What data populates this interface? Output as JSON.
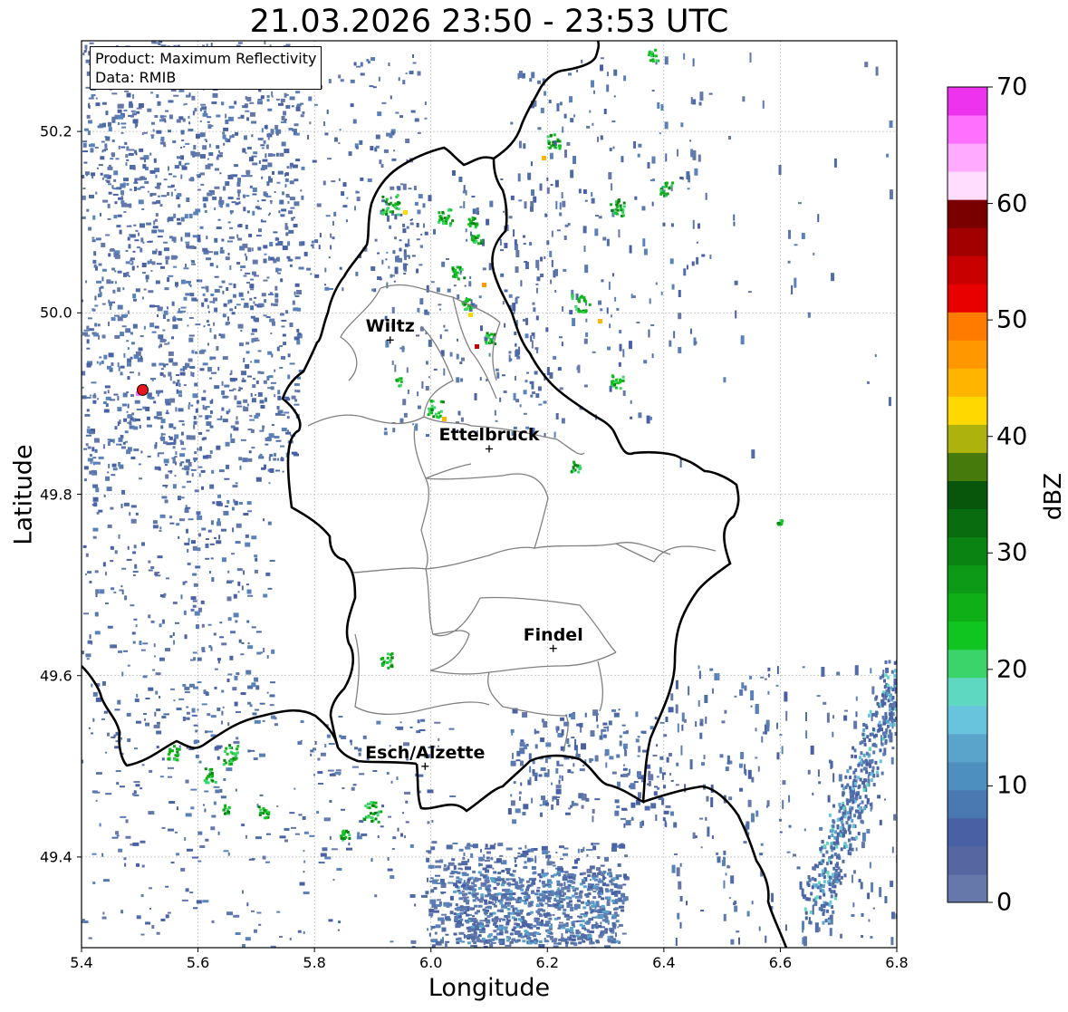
{
  "title": "21.03.2026 23:50 - 23:53 UTC",
  "xlabel": "Longitude",
  "ylabel": "Latitude",
  "info": {
    "product_line": "Product: Maximum Reflectivity",
    "data_line": "Data: RMIB"
  },
  "x_ticks": [
    "5.4",
    "5.6",
    "5.8",
    "6.0",
    "6.2",
    "6.4",
    "6.6",
    "6.8"
  ],
  "y_ticks": [
    "50.2",
    "50.0",
    "49.8",
    "49.6",
    "49.4"
  ],
  "extent": {
    "lon": [
      5.4,
      6.8
    ],
    "lat": [
      49.3,
      50.3
    ]
  },
  "grid": true,
  "cities": [
    {
      "name": "Wiltz",
      "lon": 5.93,
      "lat": 49.97
    },
    {
      "name": "Ettelbruck",
      "lon": 6.1,
      "lat": 49.85
    },
    {
      "name": "Findel",
      "lon": 6.21,
      "lat": 49.63
    },
    {
      "name": "Esch/Alzette",
      "lon": 5.99,
      "lat": 49.5
    }
  ],
  "radar_site": {
    "lon": 5.505,
    "lat": 49.915,
    "color": "#e8141e"
  },
  "colorbar": {
    "label": "dBZ",
    "ticks": [
      "0",
      "10",
      "20",
      "30",
      "40",
      "50",
      "60",
      "70"
    ],
    "range": [
      0,
      70
    ],
    "colors": [
      "#6677aa",
      "#5566a0",
      "#4a60a4",
      "#4a79b1",
      "#4d8fbe",
      "#5aa4cc",
      "#68c4dc",
      "#5fd8c2",
      "#3ad46a",
      "#10c520",
      "#0fb017",
      "#0d9a16",
      "#0b8313",
      "#096d10",
      "#08560c",
      "#477a0d",
      "#adb20d",
      "#ffd800",
      "#ffb500",
      "#ff9700",
      "#ff7b00",
      "#e80000",
      "#c80000",
      "#a20000",
      "#7a0000",
      "#ffddff",
      "#ffaaff",
      "#ff70ff",
      "#ee33ee"
    ]
  },
  "colors": {
    "border": "#000000",
    "cantons": "#808080",
    "gridline": "#b0b0b0",
    "echo_weak": "#4f6ca6",
    "echo_mid": "#5aa4cc",
    "echo_green": "#10c520"
  }
}
